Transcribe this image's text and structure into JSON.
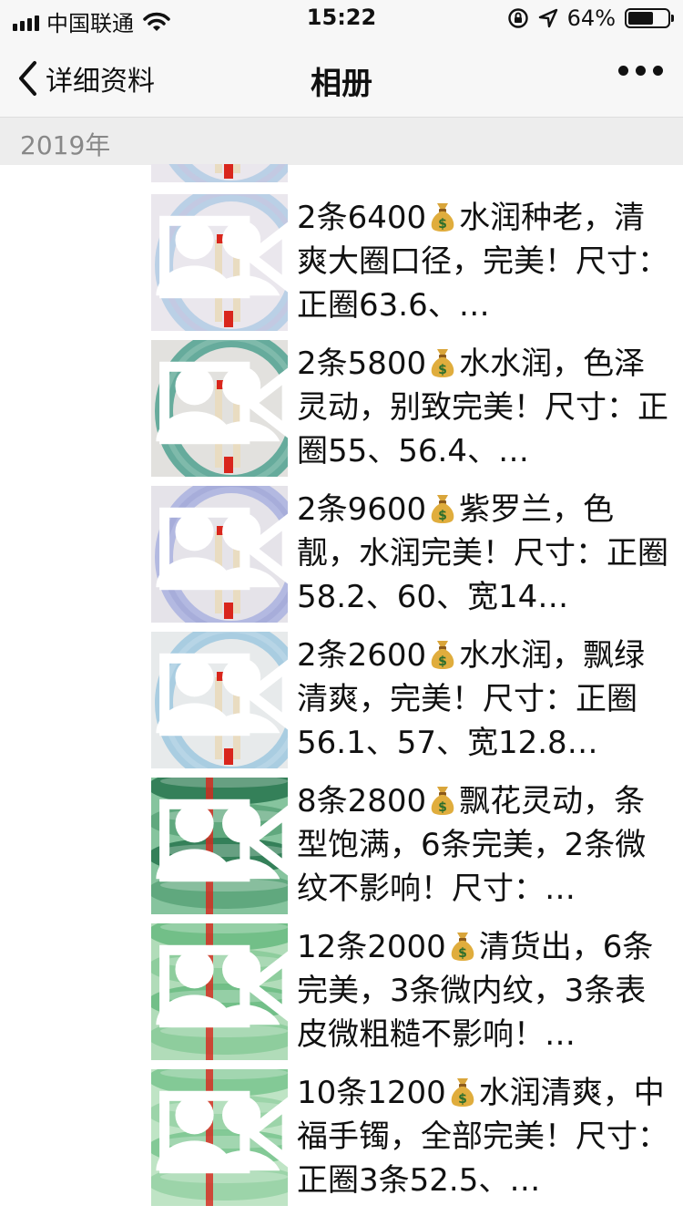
{
  "status_bar": {
    "carrier": "中国联通",
    "time": "15:22",
    "battery_percent": "64%",
    "battery_level": 0.64
  },
  "nav": {
    "back_label": "详细资料",
    "title": "相册"
  },
  "section": {
    "year": "2019年"
  },
  "colors": {
    "nav_bg": "#f7f7f7",
    "year_bg": "#ededed",
    "year_text": "#888888"
  },
  "posts": [
    {
      "prefix": "2条6400",
      "text": "水润种老，清爽大圈口径，完美！尺寸：正圈63.6、…",
      "theme": "lavender"
    },
    {
      "prefix": "2条5800",
      "text": "水水润，色泽灵动，别致完美！尺寸：正圈55、56.4、…",
      "theme": "teal"
    },
    {
      "prefix": "2条9600",
      "text": "紫罗兰，色靓，水润完美！尺寸：正圈58.2、60、宽14…",
      "theme": "purple"
    },
    {
      "prefix": "2条2600",
      "text": "水水润，飘绿清爽，完美！尺寸：正圈56.1、57、宽12.8…",
      "theme": "lightblue"
    },
    {
      "prefix": "8条2800",
      "text": "飘花灵动，条型饱满，6条完美，2条微纹不影响！尺寸：…",
      "theme": "green"
    },
    {
      "prefix": "12条2000",
      "text": "清货出，6条完美，3条微内纹，3条表皮微粗糙不影响！…",
      "theme": "mint"
    },
    {
      "prefix": "10条1200",
      "text": "水润清爽，中福手镯，全部完美！尺寸：正圈3条52.5、…",
      "theme": "palegreen"
    }
  ]
}
